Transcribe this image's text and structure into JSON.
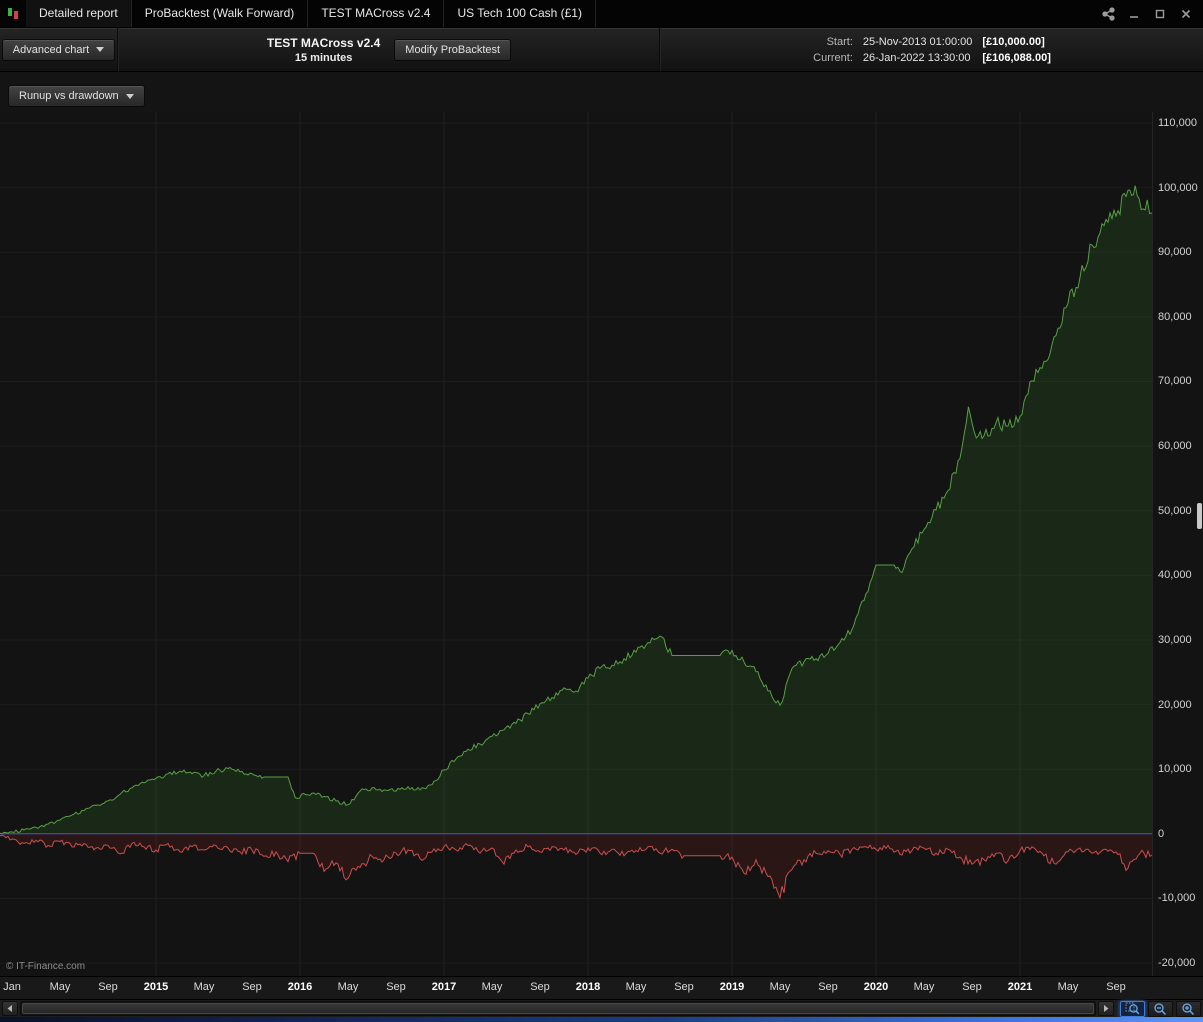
{
  "titlebar": {
    "tabs": [
      "Detailed report",
      "ProBacktest (Walk Forward)",
      "TEST MACross v2.4",
      "US Tech 100 Cash (£1)"
    ]
  },
  "toolbar": {
    "advanced_chart_label": "Advanced chart",
    "strategy_name": "TEST MACross v2.4",
    "timeframe": "15 minutes",
    "modify_button_label": "Modify ProBacktest",
    "start_label": "Start:",
    "start_datetime": "25-Nov-2013 01:00:00",
    "start_amount": "[£10,000.00]",
    "current_label": "Current:",
    "current_datetime": "26-Jan-2022 13:30:00",
    "current_amount": "[£106,088.00]"
  },
  "chart_selector": {
    "label": "Runup vs drawdown"
  },
  "copyright": "© IT-Finance.com",
  "chart_data": {
    "type": "area",
    "title": "Runup vs drawdown",
    "x_unit": "months since Dec-2013",
    "x_range": [
      0,
      96
    ],
    "ylim": [
      -22000,
      111700
    ],
    "grid": true,
    "grid_color_h": "#1c1c1c",
    "grid_color_v": "#212121",
    "zero_line_color": "#4156cc",
    "y_ticks": [
      {
        "value": 110000,
        "label": "110,000"
      },
      {
        "value": 100000,
        "label": "100,000"
      },
      {
        "value": 90000,
        "label": "90,000"
      },
      {
        "value": 80000,
        "label": "80,000"
      },
      {
        "value": 70000,
        "label": "70,000"
      },
      {
        "value": 60000,
        "label": "60,000"
      },
      {
        "value": 50000,
        "label": "50,000"
      },
      {
        "value": 40000,
        "label": "40,000"
      },
      {
        "value": 30000,
        "label": "30,000"
      },
      {
        "value": 20000,
        "label": "20,000"
      },
      {
        "value": 10000,
        "label": "10,000"
      },
      {
        "value": 0,
        "label": "0"
      },
      {
        "value": -10000,
        "label": "-10,000"
      },
      {
        "value": -20000,
        "label": "-20,000"
      }
    ],
    "x_ticks": [
      {
        "m": 1,
        "label": "Jan",
        "year": false
      },
      {
        "m": 5,
        "label": "May",
        "year": false
      },
      {
        "m": 9,
        "label": "Sep",
        "year": false
      },
      {
        "m": 13,
        "label": "2015",
        "year": true
      },
      {
        "m": 17,
        "label": "May",
        "year": false
      },
      {
        "m": 21,
        "label": "Sep",
        "year": false
      },
      {
        "m": 25,
        "label": "2016",
        "year": true
      },
      {
        "m": 29,
        "label": "May",
        "year": false
      },
      {
        "m": 33,
        "label": "Sep",
        "year": false
      },
      {
        "m": 37,
        "label": "2017",
        "year": true
      },
      {
        "m": 41,
        "label": "May",
        "year": false
      },
      {
        "m": 45,
        "label": "Sep",
        "year": false
      },
      {
        "m": 49,
        "label": "2018",
        "year": true
      },
      {
        "m": 53,
        "label": "May",
        "year": false
      },
      {
        "m": 57,
        "label": "Sep",
        "year": false
      },
      {
        "m": 61,
        "label": "2019",
        "year": true
      },
      {
        "m": 65,
        "label": "May",
        "year": false
      },
      {
        "m": 69,
        "label": "Sep",
        "year": false
      },
      {
        "m": 73,
        "label": "2020",
        "year": true
      },
      {
        "m": 77,
        "label": "May",
        "year": false
      },
      {
        "m": 81,
        "label": "Sep",
        "year": false
      },
      {
        "m": 85,
        "label": "2021",
        "year": true
      },
      {
        "m": 89,
        "label": "May",
        "year": false
      },
      {
        "m": 93,
        "label": "Sep",
        "year": false
      }
    ],
    "series": [
      {
        "name": "runup",
        "color": "#55a042",
        "fill": "rgba(70,160,50,0.15)",
        "points": [
          [
            0,
            100
          ],
          [
            1,
            300
          ],
          [
            2,
            600
          ],
          [
            3,
            1000
          ],
          [
            4,
            1500
          ],
          [
            5,
            2100
          ],
          [
            6,
            2900
          ],
          [
            7,
            3600
          ],
          [
            8,
            4400
          ],
          [
            9,
            5100
          ],
          [
            10,
            6100
          ],
          [
            11,
            7100
          ],
          [
            12,
            7900
          ],
          [
            13,
            8600
          ],
          [
            14,
            9300
          ],
          [
            15,
            9700
          ],
          [
            16,
            9300
          ],
          [
            17,
            9000
          ],
          [
            18,
            9700
          ],
          [
            19,
            10100
          ],
          [
            20,
            9600
          ],
          [
            21,
            9300
          ],
          [
            22,
            8800
          ],
          [
            24,
            8800
          ],
          [
            24.6,
            5600
          ],
          [
            26,
            6300
          ],
          [
            27,
            5800
          ],
          [
            28,
            5100
          ],
          [
            29,
            4500
          ],
          [
            30,
            6600
          ],
          [
            31,
            7100
          ],
          [
            32,
            6800
          ],
          [
            33,
            6600
          ],
          [
            34,
            7300
          ],
          [
            35,
            6800
          ],
          [
            36,
            7600
          ],
          [
            37,
            9900
          ],
          [
            38,
            11600
          ],
          [
            39,
            13100
          ],
          [
            40,
            13900
          ],
          [
            41,
            15100
          ],
          [
            42,
            16100
          ],
          [
            43,
            17100
          ],
          [
            44,
            18600
          ],
          [
            45,
            20100
          ],
          [
            46,
            21100
          ],
          [
            47,
            22600
          ],
          [
            48,
            22100
          ],
          [
            49,
            24100
          ],
          [
            50,
            25600
          ],
          [
            51,
            26100
          ],
          [
            52,
            27100
          ],
          [
            53,
            28100
          ],
          [
            54,
            29600
          ],
          [
            55,
            30600
          ],
          [
            56,
            27600
          ],
          [
            60,
            27600
          ],
          [
            61,
            28400
          ],
          [
            62,
            26600
          ],
          [
            63,
            25100
          ],
          [
            64,
            22100
          ],
          [
            65,
            19900
          ],
          [
            66,
            25600
          ],
          [
            67,
            26600
          ],
          [
            68,
            27100
          ],
          [
            69,
            27900
          ],
          [
            70,
            29600
          ],
          [
            71,
            31600
          ],
          [
            72,
            36100
          ],
          [
            73,
            41600
          ],
          [
            74.5,
            41600
          ],
          [
            75,
            40600
          ],
          [
            76,
            44100
          ],
          [
            77,
            47100
          ],
          [
            78,
            50100
          ],
          [
            79,
            53100
          ],
          [
            80,
            58100
          ],
          [
            80.7,
            66100
          ],
          [
            81.2,
            62100
          ],
          [
            82,
            61600
          ],
          [
            83,
            63600
          ],
          [
            84,
            63100
          ],
          [
            85,
            64600
          ],
          [
            86,
            70100
          ],
          [
            87,
            73100
          ],
          [
            88,
            77100
          ],
          [
            89,
            82100
          ],
          [
            90,
            86100
          ],
          [
            91,
            91100
          ],
          [
            92,
            94100
          ],
          [
            93,
            95600
          ],
          [
            94,
            99600
          ],
          [
            94.6,
            100300
          ],
          [
            95.1,
            96600
          ],
          [
            95.6,
            98100
          ],
          [
            96,
            96100
          ]
        ]
      },
      {
        "name": "drawdown",
        "color": "#c94f4f",
        "fill": "rgba(190,45,45,0.14)",
        "points": [
          [
            0,
            -300
          ],
          [
            1,
            -800
          ],
          [
            2,
            -1500
          ],
          [
            3,
            -1000
          ],
          [
            4,
            -1800
          ],
          [
            5,
            -1200
          ],
          [
            6,
            -2000
          ],
          [
            7,
            -1500
          ],
          [
            8,
            -2200
          ],
          [
            9,
            -1800
          ],
          [
            10,
            -3100
          ],
          [
            11,
            -1500
          ],
          [
            12,
            -2000
          ],
          [
            13,
            -2500
          ],
          [
            14,
            -1500
          ],
          [
            15,
            -2800
          ],
          [
            16,
            -2000
          ],
          [
            17,
            -2500
          ],
          [
            18,
            -1800
          ],
          [
            19,
            -2200
          ],
          [
            20,
            -2800
          ],
          [
            21,
            -2500
          ],
          [
            22,
            -3500
          ],
          [
            23,
            -2800
          ],
          [
            24,
            -4300
          ],
          [
            25,
            -3000
          ],
          [
            26,
            -3000
          ],
          [
            27,
            -5800
          ],
          [
            28,
            -4500
          ],
          [
            29,
            -6900
          ],
          [
            30,
            -5200
          ],
          [
            31,
            -3500
          ],
          [
            32,
            -4000
          ],
          [
            33,
            -3000
          ],
          [
            34,
            -2500
          ],
          [
            35,
            -3800
          ],
          [
            36,
            -2800
          ],
          [
            37,
            -2000
          ],
          [
            38,
            -2500
          ],
          [
            39,
            -1800
          ],
          [
            40,
            -3000
          ],
          [
            41,
            -2200
          ],
          [
            42,
            -4700
          ],
          [
            43,
            -2500
          ],
          [
            44,
            -2000
          ],
          [
            45,
            -2800
          ],
          [
            46,
            -2000
          ],
          [
            47,
            -2500
          ],
          [
            48,
            -3200
          ],
          [
            49,
            -2200
          ],
          [
            50,
            -3000
          ],
          [
            51,
            -2400
          ],
          [
            52,
            -3400
          ],
          [
            53,
            -2600
          ],
          [
            54,
            -2000
          ],
          [
            55,
            -3000
          ],
          [
            56,
            -2400
          ],
          [
            57,
            -3400
          ],
          [
            60,
            -3400
          ],
          [
            61,
            -3600
          ],
          [
            62,
            -6100
          ],
          [
            63,
            -4000
          ],
          [
            64,
            -6600
          ],
          [
            65,
            -9900
          ],
          [
            66,
            -5500
          ],
          [
            67,
            -4000
          ],
          [
            68,
            -3000
          ],
          [
            69,
            -2600
          ],
          [
            70,
            -3200
          ],
          [
            71,
            -2400
          ],
          [
            72,
            -2000
          ],
          [
            73,
            -2400
          ],
          [
            74,
            -1800
          ],
          [
            75,
            -3200
          ],
          [
            76,
            -2600
          ],
          [
            77,
            -2200
          ],
          [
            78,
            -3000
          ],
          [
            79,
            -2400
          ],
          [
            80,
            -3600
          ],
          [
            81,
            -4700
          ],
          [
            82,
            -4000
          ],
          [
            83,
            -3000
          ],
          [
            84,
            -4200
          ],
          [
            85,
            -2600
          ],
          [
            86,
            -2000
          ],
          [
            87,
            -3400
          ],
          [
            88,
            -4700
          ],
          [
            89,
            -2800
          ],
          [
            90,
            -2200
          ],
          [
            91,
            -3000
          ],
          [
            92,
            -2400
          ],
          [
            93,
            -2800
          ],
          [
            94,
            -5300
          ],
          [
            95,
            -3000
          ],
          [
            96,
            -3300
          ]
        ]
      }
    ]
  }
}
